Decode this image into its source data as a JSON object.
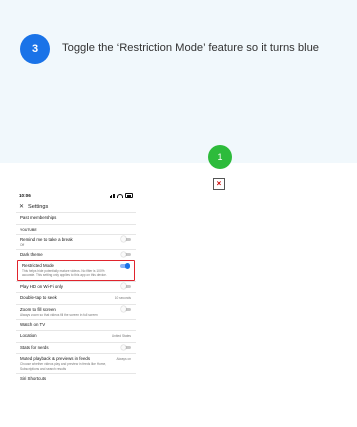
{
  "tutorial": {
    "step_number": "3",
    "instruction": "Toggle the ‘Restriction Mode’ feature so it turns blue",
    "hint_number": "1"
  },
  "colors": {
    "accent": "#1a73e8",
    "hint": "#2dbb3b",
    "highlight_border": "#e0242d",
    "band": "#f1f8fc"
  },
  "phone": {
    "status": {
      "time": "10:06"
    },
    "header": {
      "title": "Settings"
    },
    "settings": {
      "past_memberships": "Past memberships",
      "section_youtube": "YOUTUBE",
      "remind_break": {
        "title": "Remind me to take a break",
        "sub": "Off",
        "toggle_on": false
      },
      "dark_theme": {
        "title": "Dark theme",
        "toggle_on": false
      },
      "restricted_mode": {
        "title": "Restricted Mode",
        "sub": "This helps hide potentially mature videos. No filter is 100% accurate. This setting only applies to this app on this device.",
        "toggle_on": true
      },
      "play_hd_wifi": {
        "title": "Play HD on Wi-Fi only",
        "toggle_on": false
      },
      "double_tap": {
        "title": "Double-tap to seek",
        "value": "10 seconds"
      },
      "zoom_fill": {
        "title": "Zoom to fill screen",
        "sub": "Always zoom so that videos fill the screen in full screen",
        "toggle_on": false
      },
      "watch_tv": {
        "title": "Watch on TV"
      },
      "location": {
        "title": "Location",
        "value": "United States"
      },
      "stats_nerds": {
        "title": "Stats for nerds",
        "toggle_on": false
      },
      "muted_playback": {
        "title": "Muted playback & previews in feeds",
        "value": "Always on",
        "sub": "Choose whether videos play and preview in feeds like Home, Subscriptions and search results"
      },
      "siri_shortcuts": {
        "title": "Siri Shortcuts"
      }
    }
  }
}
